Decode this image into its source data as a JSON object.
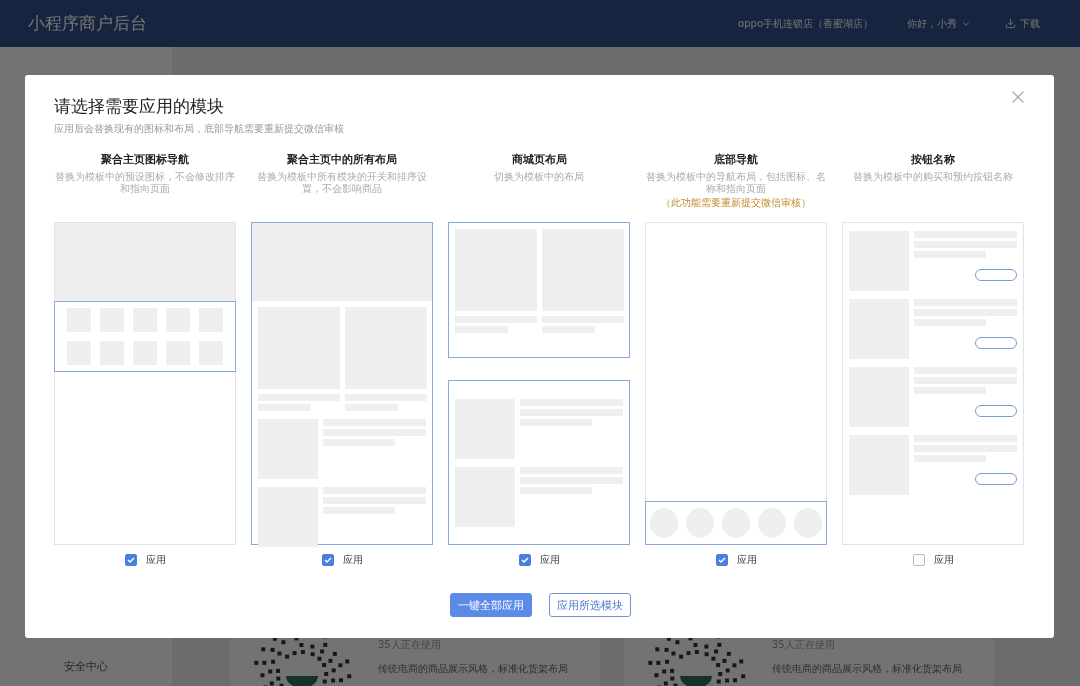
{
  "app": {
    "title": "小程序商户后台",
    "store": "oppo手机连锁店（香蜜湖店）",
    "greeting": "你好，小秀",
    "download": "下载"
  },
  "sidebar": {
    "items": [
      "安全中心"
    ]
  },
  "templates": [
    {
      "users": "35人正在使用",
      "description": "传统电商的商品展示风格，标准化货架布局"
    },
    {
      "users": "35人正在使用",
      "description": "传统电商的商品展示风格，标准化货架布局"
    }
  ],
  "dialog": {
    "title": "请选择需要应用的模块",
    "subtitle": "应用后会替换现有的图标和布局，底部导航需要重新提交微信审核",
    "modules": [
      {
        "kind": "icon-nav",
        "title": "聚合主页图标导航",
        "description": "替换为模板中的预设图标，不会修改排序和指向页面",
        "apply_label": "应用",
        "checked": true
      },
      {
        "kind": "all-layout",
        "title": "聚合主页中的所有布局",
        "description": "替换为模板中所有模块的开关和排序设置，不会影响商品",
        "apply_label": "应用",
        "checked": true
      },
      {
        "kind": "shop-layout",
        "title": "商城页布局",
        "description": "切换为模板中的布局",
        "apply_label": "应用",
        "checked": true
      },
      {
        "kind": "bottom-nav",
        "title": "底部导航",
        "description": "替换为模板中的导航布局，包括图标、名称和指向页面",
        "note": "（此功能需要重新提交微信审核）",
        "apply_label": "应用",
        "checked": true
      },
      {
        "kind": "button-name",
        "title": "按钮名称",
        "description": "替换为模板中的购买和预约按钮名称",
        "apply_label": "应用",
        "checked": false
      }
    ],
    "buttons": [
      {
        "label": "一键全部应用",
        "kind": "primary"
      },
      {
        "label": "应用所选模块",
        "kind": "secondary"
      }
    ]
  }
}
